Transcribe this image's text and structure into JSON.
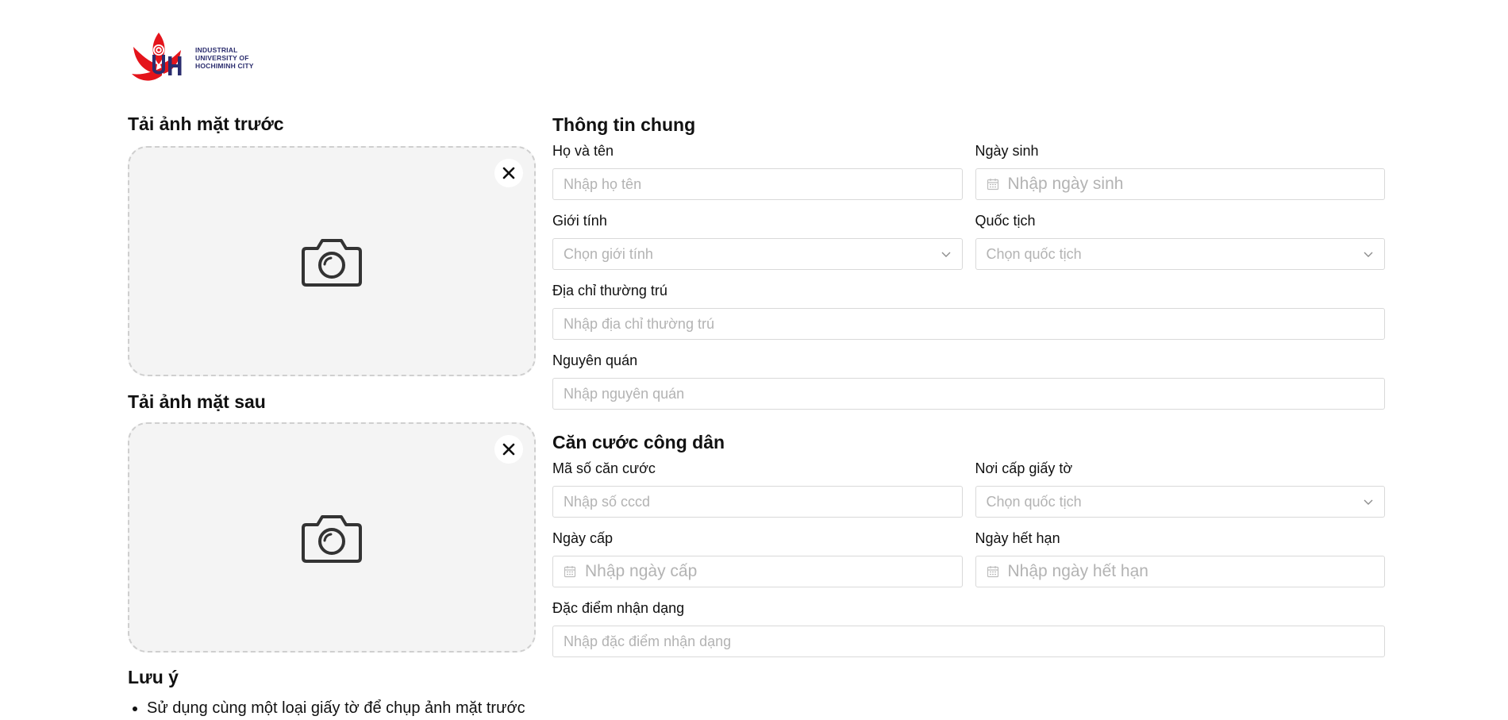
{
  "logo": {
    "line1": "INDUSTRIAL",
    "line2": "UNIVERSITY OF",
    "line3": "HOCHIMINH CITY",
    "brand_red": "#e4141b",
    "brand_blue": "#2b2d6e"
  },
  "front_upload": {
    "title": "Tải ảnh mặt trước",
    "icon": "camera-icon",
    "close_icon": "close-icon"
  },
  "back_upload": {
    "title": "Tải ảnh mặt sau",
    "icon": "camera-icon",
    "close_icon": "close-icon"
  },
  "notes": {
    "title": "Lưu ý",
    "items": [
      "Sử dụng cùng một loại giấy tờ để chụp ảnh mặt trước và sau"
    ]
  },
  "general": {
    "title": "Thông tin chung",
    "full_name": {
      "label": "Họ và tên",
      "placeholder": "Nhập họ tên"
    },
    "birth_date": {
      "label": "Ngày sinh",
      "placeholder": "Nhập ngày sinh"
    },
    "gender": {
      "label": "Giới tính",
      "placeholder": "Chọn giới tính"
    },
    "nationality": {
      "label": "Quốc tịch",
      "placeholder": "Chọn quốc tịch"
    },
    "permanent_address": {
      "label": "Địa chỉ thường trú",
      "placeholder": "Nhập địa chỉ thường trú"
    },
    "hometown": {
      "label": "Nguyên quán",
      "placeholder": "Nhập nguyên quán"
    }
  },
  "citizen_id": {
    "title": "Căn cước công dân",
    "id_number": {
      "label": "Mã số căn cước",
      "placeholder": "Nhập số cccd"
    },
    "issue_place": {
      "label": "Nơi cấp giấy tờ",
      "placeholder": "Chọn quốc tịch"
    },
    "issue_date": {
      "label": "Ngày cấp",
      "placeholder": "Nhập ngày cấp"
    },
    "expiry_date": {
      "label": "Ngày hết hạn",
      "placeholder": "Nhập ngày hết hạn"
    },
    "identifying_marks": {
      "label": "Đặc điểm nhận dạng",
      "placeholder": "Nhập đặc điểm nhận dạng"
    }
  }
}
